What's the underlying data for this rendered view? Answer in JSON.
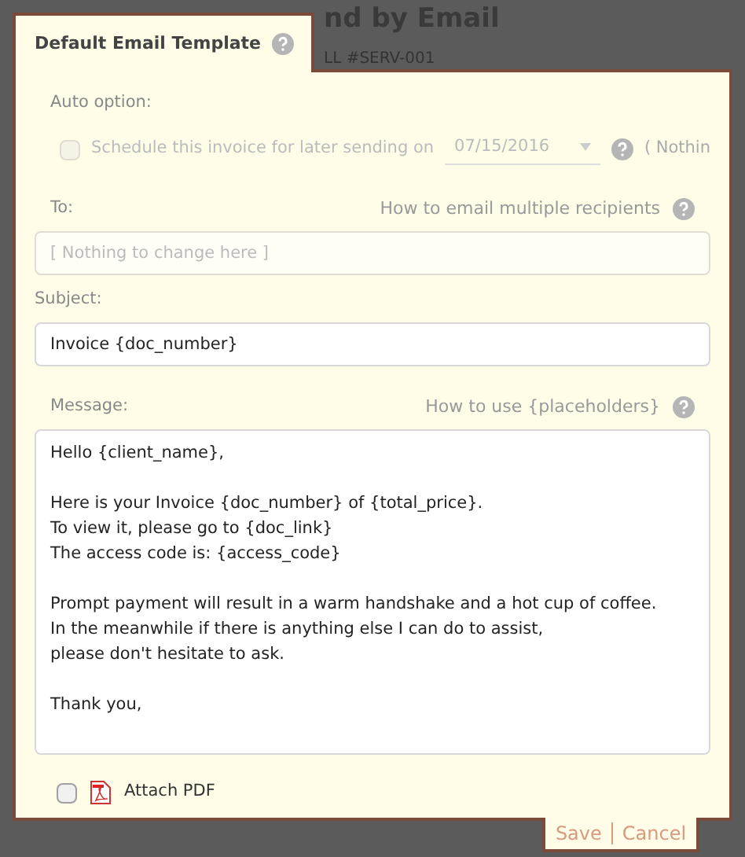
{
  "header": {
    "title": "nd by Email",
    "subtitle": "LL #SERV-001"
  },
  "tab": {
    "label": "Default Email Template"
  },
  "auto_option": {
    "label": "Auto option:",
    "schedule_label": "Schedule this invoice for later sending on",
    "checked": false,
    "disabled": true,
    "date": "07/15/2016",
    "note": "( Nothin"
  },
  "to": {
    "label": "To:",
    "help": "How to email multiple recipients",
    "placeholder": "[ Nothing to change here ]"
  },
  "subject": {
    "label": "Subject:",
    "value": "Invoice {doc_number}"
  },
  "message": {
    "label": "Message:",
    "help": "How to use {placeholders}",
    "value": "Hello {client_name},\n\nHere is your Invoice {doc_number} of {total_price}.\nTo view it, please go to {doc_link}\nThe access code is: {access_code}\n\nPrompt payment will result in a warm handshake and a hot cup of coffee.\nIn the meanwhile if there is anything else I can do to assist,\nplease don't hesitate to ask.\n\nThank you,"
  },
  "attach_pdf": {
    "label": "Attach PDF",
    "checked": false
  },
  "actions": [
    "Save",
    "Cancel"
  ]
}
